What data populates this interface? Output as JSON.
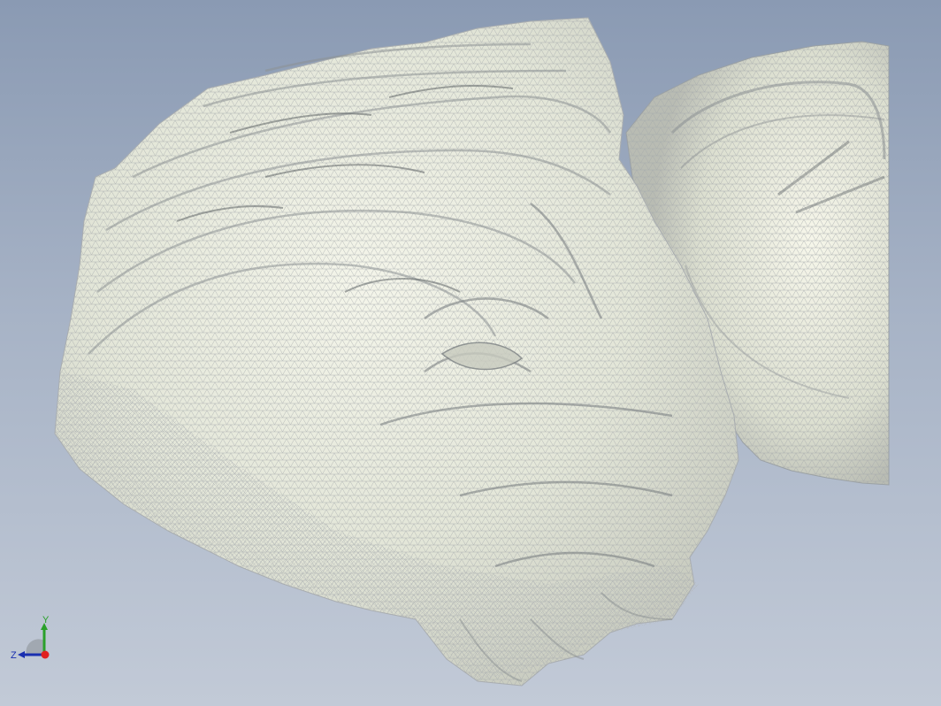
{
  "viewport": {
    "background_top": "#8a9ab3",
    "background_bottom": "#c2cad7"
  },
  "model": {
    "name": "scanned-sculpture-head",
    "display_mode": "shaded-with-edges",
    "surface_color": "#e9ebdf",
    "edge_color": "#9ea3a6"
  },
  "triad": {
    "y_label": "Y",
    "z_label": "Z",
    "y_color": "#2aa02a",
    "z_color": "#1a2fb0",
    "x_color": "#e02020"
  }
}
